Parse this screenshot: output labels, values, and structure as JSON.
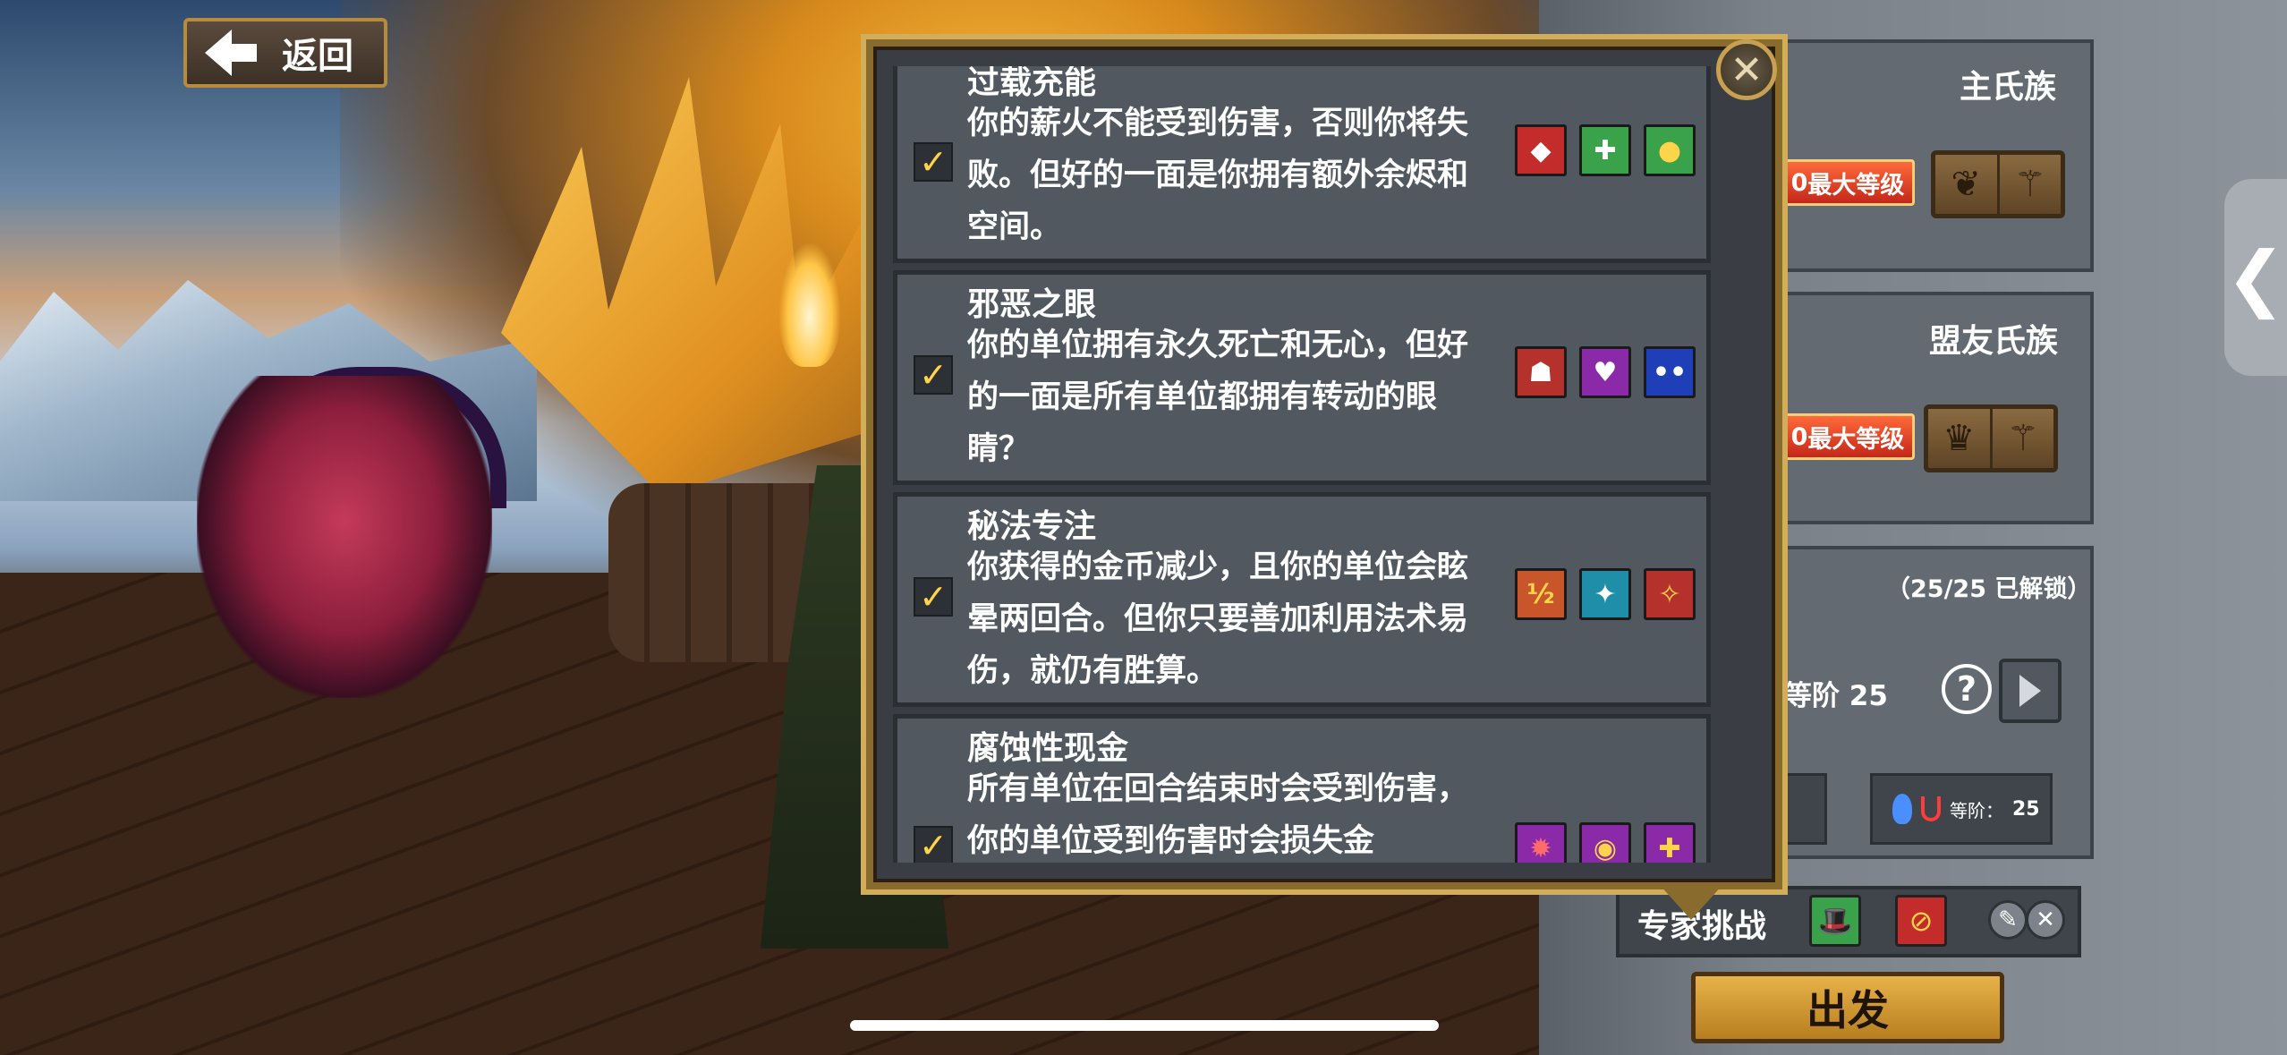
{
  "back_button": {
    "label": "返回"
  },
  "modal": {
    "options": [
      {
        "name": "过载充能",
        "desc": "你的薪火不能受到伤害，否则你将失败。但好的一面是你拥有额外余烬和空间。",
        "checked": "✓",
        "icons": [
          {
            "name": "shield-ember-icon",
            "color": "#c42b2b",
            "glyph": "◆"
          },
          {
            "name": "health-cross-icon",
            "color": "#3aa24a",
            "glyph": "✚"
          },
          {
            "name": "orbs-icon",
            "color": "#3aa24a",
            "glyph": "●"
          }
        ]
      },
      {
        "name": "邪恶之眼",
        "desc": "你的单位拥有永久死亡和无心，但好的一面是所有单位都拥有转动的眼睛？",
        "checked": "✓",
        "icons": [
          {
            "name": "tombstone-icon",
            "color": "#b5312c",
            "glyph": "☗"
          },
          {
            "name": "heartless-icon",
            "color": "#8a2aa8",
            "glyph": "♥"
          },
          {
            "name": "googly-eyes-icon",
            "color": "#1f3fb8",
            "glyph": "••"
          }
        ]
      },
      {
        "name": "秘法专注",
        "desc": "你获得的金币减少，且你的单位会眩晕两回合。但你只要善加利用法术易伤，就仍有胜算。",
        "checked": "✓",
        "icons": [
          {
            "name": "half-gold-icon",
            "color": "#c9562a",
            "glyph": "½"
          },
          {
            "name": "stun-icon",
            "color": "#1f8fa8",
            "glyph": "✦"
          },
          {
            "name": "spell-weakness-icon",
            "color": "#b5312c",
            "glyph": "✧"
          }
        ]
      },
      {
        "name": "腐蚀性现金",
        "desc": "所有单位在回合结束时会受到伤害，你的单位受到伤害时会损失金",
        "checked": "✓",
        "icons": [
          {
            "name": "damage-icon",
            "color": "#8a2aa8",
            "glyph": "✹"
          },
          {
            "name": "coin-loss-icon",
            "color": "#8a2aa8",
            "glyph": "◉"
          },
          {
            "name": "sword-icon",
            "color": "#8a2aa8",
            "glyph": "✚"
          }
        ]
      }
    ]
  },
  "right_panel": {
    "main_clan": {
      "title": "主氏族",
      "rank": "最大等级",
      "rank_prefix": "0"
    },
    "ally_clan": {
      "title": "盟友氏族",
      "rank": "最大等级",
      "rank_prefix": "0"
    },
    "covenant": {
      "unlocked": "（25/25 已解锁）",
      "tier": "等阶 25"
    },
    "stat": {
      "label": "等阶：",
      "value": "25"
    },
    "expert_challenge": {
      "label": "专家挑战"
    },
    "go_button": {
      "label": "出发"
    },
    "help": "?",
    "side_tab": "❮"
  },
  "colors": {
    "gold_border": "#8a6b2e",
    "check": "#ffd44a",
    "go": "#e7b24a"
  }
}
